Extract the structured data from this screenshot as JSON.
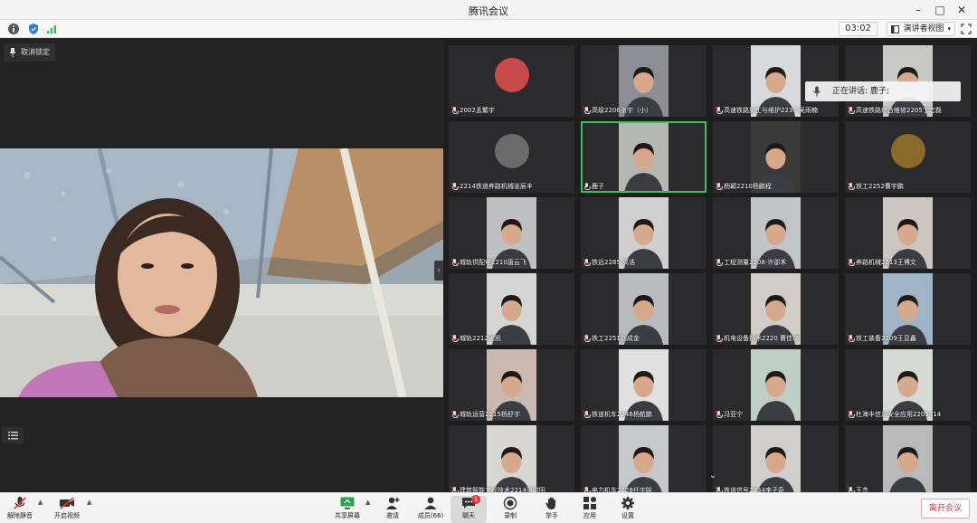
{
  "window": {
    "title": "腾讯会议",
    "minimize": "–",
    "maximize": "□",
    "close": "✕"
  },
  "infobar": {
    "timer": "03:02",
    "view_label": "演讲者视图"
  },
  "main": {
    "unpin_label": "取消锁定",
    "collapse_glyph": "›"
  },
  "speaking": {
    "label": "正在讲话: 鹿子;"
  },
  "participants": [
    {
      "name": "2002孟繁宇",
      "kind": "avatar",
      "tone": "#c94a4a",
      "muted": true
    },
    {
      "name": "高级2206张宇（小）",
      "kind": "video",
      "tone": "#8d8e93",
      "muted": true
    },
    {
      "name": "高速铁路施工与维护2230 吴雨楠",
      "kind": "video",
      "tone": "#d8d9dc",
      "muted": true
    },
    {
      "name": "高速铁路综合维修2205丁宏磊",
      "kind": "video",
      "tone": "#c8c9c6",
      "muted": true
    },
    {
      "name": "2214铁道养路机械张辰丰",
      "kind": "avatar",
      "tone": "#6b6b6b",
      "muted": true
    },
    {
      "name": "鹿子",
      "kind": "video",
      "tone": "#b5b7b2",
      "muted": false,
      "speaking": true
    },
    {
      "name": "杨颖2210杨鹏程",
      "kind": "video",
      "tone": "#3a3a3a",
      "muted": true
    },
    {
      "name": "铁工2252曹宇鹏",
      "kind": "avatar",
      "tone": "#8a6a2a",
      "muted": true
    },
    {
      "name": "城轨供配电2210唐云飞",
      "kind": "video",
      "tone": "#bfc0c2",
      "muted": true
    },
    {
      "name": "铁远2285 高浩",
      "kind": "video",
      "tone": "#cfcfcf",
      "muted": true
    },
    {
      "name": "工程测量2208-许邵禾",
      "kind": "video",
      "tone": "#c2c5c8",
      "muted": true
    },
    {
      "name": "养路机械2213王博文",
      "kind": "video",
      "tone": "#cbc7c0",
      "muted": true
    },
    {
      "name": "城轨2212张凯",
      "kind": "video",
      "tone": "#d5d5d5",
      "muted": true
    },
    {
      "name": "铁工2251刘成金",
      "kind": "video",
      "tone": "#b9bcbf",
      "muted": true
    },
    {
      "name": "机电设备技术2220 曹佳琦",
      "kind": "video",
      "tone": "#d0ccc6",
      "muted": true
    },
    {
      "name": "铁工装备2209王显鑫",
      "kind": "video",
      "tone": "#9fb4c4",
      "muted": true
    },
    {
      "name": "城轨运营2215杨舒宇",
      "kind": "video",
      "tone": "#c9b9b0",
      "muted": true
    },
    {
      "name": "铁道机车2246杨航鹏",
      "kind": "video",
      "tone": "#e0e0e0",
      "muted": true
    },
    {
      "name": "冯亚宁",
      "kind": "video",
      "tone": "#bfcfc6",
      "muted": true
    },
    {
      "name": "杜海丰信息安全应用2205414",
      "kind": "video",
      "tone": "#d6dad7",
      "muted": true
    },
    {
      "name": "建筑智能工程技术2214张洪阳",
      "kind": "video",
      "tone": "#d8d6d2",
      "muted": true
    },
    {
      "name": "电力机车2228任宇晗",
      "kind": "video",
      "tone": "#c6c8ca",
      "muted": true
    },
    {
      "name": "铁道信号2234李子奇",
      "kind": "video",
      "tone": "#d0cfcc",
      "muted": true
    },
    {
      "name": "王杰",
      "kind": "video",
      "tone": "#b9b9b9",
      "muted": true
    }
  ],
  "toolbar": {
    "unmute": "解除静音",
    "start_video": "开启视频",
    "share_screen": "共享屏幕",
    "invite": "邀请",
    "members": "成员(66)",
    "chat": "聊天",
    "chat_badge": "1",
    "record": "录制",
    "raise_hand": "举手",
    "apps": "应用",
    "settings": "设置",
    "leave": "离开会议"
  }
}
